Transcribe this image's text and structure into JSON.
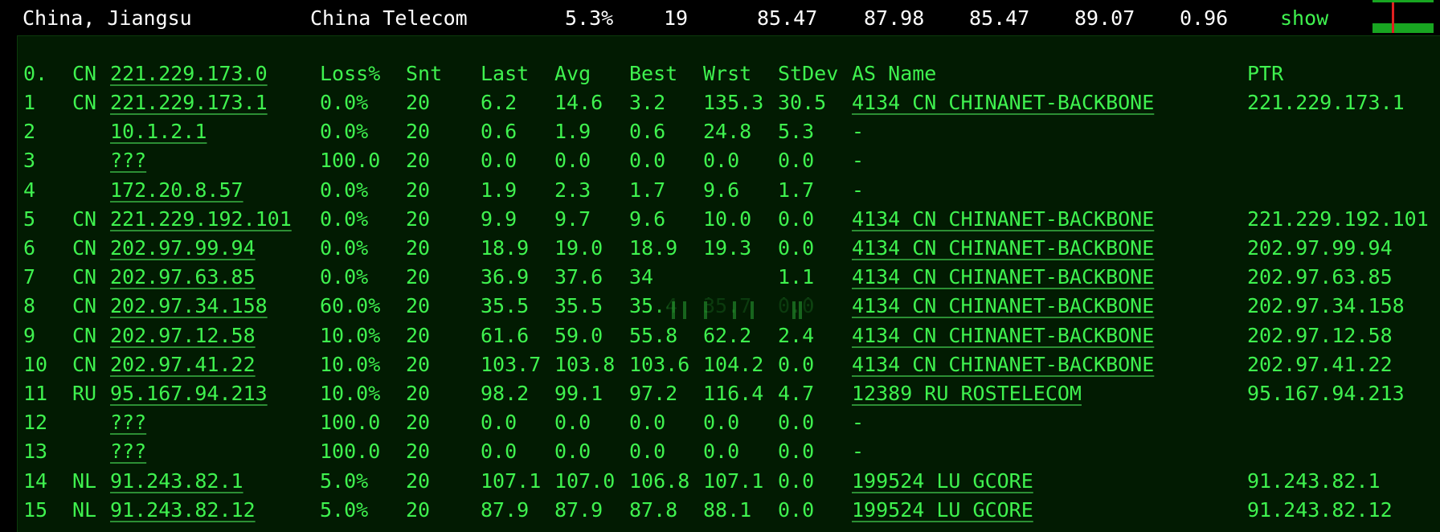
{
  "summary": {
    "location": "China, Jiangsu",
    "isp": "China Telecom",
    "loss": "5.3%",
    "sent": "19",
    "last": "85.47",
    "avg": "87.98",
    "best": "85.47",
    "worst": "89.07",
    "stdev": "0.96",
    "show_label": "show"
  },
  "header": {
    "hop": "0.",
    "cc": "CN",
    "host": "221.229.173.0",
    "loss": "Loss%",
    "snt": "Snt",
    "last": "Last",
    "avg": "Avg",
    "best": "Best",
    "wrst": "Wrst",
    "stdev": "StDev",
    "as_name": "AS Name",
    "ptr": "PTR"
  },
  "hops": [
    {
      "hop": "1",
      "cc": "CN",
      "host": "221.229.173.1",
      "loss": "0.0%",
      "snt": "20",
      "last": "6.2",
      "avg": "14.6",
      "best": "3.2",
      "wrst": "135.3",
      "stdev": "30.5",
      "as": "4134  CN CHINANET-BACKBONE",
      "ptr": "221.229.173.1"
    },
    {
      "hop": "2",
      "cc": "",
      "host": "10.1.2.1",
      "loss": "0.0%",
      "snt": "20",
      "last": "0.6",
      "avg": "1.9",
      "best": "0.6",
      "wrst": "24.8",
      "stdev": "5.3",
      "as": "-",
      "ptr": ""
    },
    {
      "hop": "3",
      "cc": "",
      "host": "???",
      "loss": "100.0",
      "snt": "20",
      "last": "0.0",
      "avg": "0.0",
      "best": "0.0",
      "wrst": "0.0",
      "stdev": "0.0",
      "as": "-",
      "ptr": ""
    },
    {
      "hop": "4",
      "cc": "",
      "host": "172.20.8.57",
      "loss": "0.0%",
      "snt": "20",
      "last": "1.9",
      "avg": "2.3",
      "best": "1.7",
      "wrst": "9.6",
      "stdev": "1.7",
      "as": "-",
      "ptr": ""
    },
    {
      "hop": "5",
      "cc": "CN",
      "host": "221.229.192.101",
      "loss": "0.0%",
      "snt": "20",
      "last": "9.9",
      "avg": "9.7",
      "best": "9.6",
      "wrst": "10.0",
      "stdev": "0.0",
      "as": "4134  CN CHINANET-BACKBONE",
      "ptr": "221.229.192.101"
    },
    {
      "hop": "6",
      "cc": "CN",
      "host": "202.97.99.94",
      "loss": "0.0%",
      "snt": "20",
      "last": "18.9",
      "avg": "19.0",
      "best": "18.9",
      "wrst": "19.3",
      "stdev": "0.0",
      "as": "4134  CN CHINANET-BACKBONE",
      "ptr": "202.97.99.94"
    },
    {
      "hop": "7",
      "cc": "CN",
      "host": "202.97.63.85",
      "loss": "0.0%",
      "snt": "20",
      "last": "36.9",
      "avg": "37.6",
      "best": "34",
      "wrst": "",
      "stdev": "1.1",
      "as": "4134  CN CHINANET-BACKBONE",
      "ptr": "202.97.63.85"
    },
    {
      "hop": "8",
      "cc": "CN",
      "host": "202.97.34.158",
      "loss": "60.0%",
      "snt": "20",
      "last": "35.5",
      "avg": "35.5",
      "best": "35.4",
      "wrst": "35.7",
      "stdev": "0.0",
      "as": "4134  CN CHINANET-BACKBONE",
      "ptr": "202.97.34.158"
    },
    {
      "hop": "9",
      "cc": "CN",
      "host": "202.97.12.58",
      "loss": "10.0%",
      "snt": "20",
      "last": "61.6",
      "avg": "59.0",
      "best": "55.8",
      "wrst": "62.2",
      "stdev": "2.4",
      "as": "4134  CN CHINANET-BACKBONE",
      "ptr": "202.97.12.58"
    },
    {
      "hop": "10",
      "cc": "CN",
      "host": "202.97.41.22",
      "loss": "10.0%",
      "snt": "20",
      "last": "103.7",
      "avg": "103.8",
      "best": "103.6",
      "wrst": "104.2",
      "stdev": "0.0",
      "as": "4134  CN CHINANET-BACKBONE",
      "ptr": "202.97.41.22"
    },
    {
      "hop": "11",
      "cc": "RU",
      "host": "95.167.94.213",
      "loss": "10.0%",
      "snt": "20",
      "last": "98.2",
      "avg": "99.1",
      "best": "97.2",
      "wrst": "116.4",
      "stdev": "4.7",
      "as": "12389 RU ROSTELECOM",
      "ptr": "95.167.94.213"
    },
    {
      "hop": "12",
      "cc": "",
      "host": "???",
      "loss": "100.0",
      "snt": "20",
      "last": "0.0",
      "avg": "0.0",
      "best": "0.0",
      "wrst": "0.0",
      "stdev": "0.0",
      "as": "-",
      "ptr": ""
    },
    {
      "hop": "13",
      "cc": "",
      "host": "???",
      "loss": "100.0",
      "snt": "20",
      "last": "0.0",
      "avg": "0.0",
      "best": "0.0",
      "wrst": "0.0",
      "stdev": "0.0",
      "as": "-",
      "ptr": ""
    },
    {
      "hop": "14",
      "cc": "NL",
      "host": "91.243.82.1",
      "loss": "5.0%",
      "snt": "20",
      "last": "107.1",
      "avg": "107.0",
      "best": "106.8",
      "wrst": "107.1",
      "stdev": "0.0",
      "as": "199524 LU GCORE",
      "ptr": "91.243.82.1"
    },
    {
      "hop": "15",
      "cc": "NL",
      "host": "91.243.82.12",
      "loss": "5.0%",
      "snt": "20",
      "last": "87.9",
      "avg": "87.9",
      "best": "87.8",
      "wrst": "88.1",
      "stdev": "0.0",
      "as": "199524 LU GCORE",
      "ptr": "91.243.82.12"
    }
  ]
}
